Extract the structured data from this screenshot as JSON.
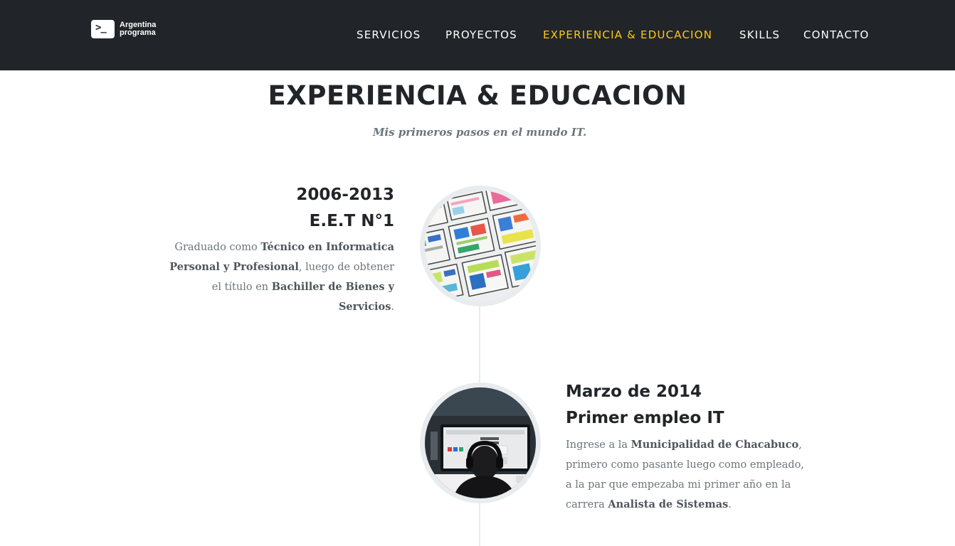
{
  "brand": {
    "prompt": ">_",
    "line1": "Argentina",
    "line2": "programa"
  },
  "nav": {
    "items": [
      {
        "label": "SERVICIOS",
        "active": false
      },
      {
        "label": "PROYECTOS",
        "active": false
      },
      {
        "label": "EXPERIENCIA & EDUCACION",
        "active": true
      },
      {
        "label": "SKILLS",
        "active": false
      },
      {
        "label": "CONTACTO",
        "active": false
      }
    ]
  },
  "section": {
    "heading": "EXPERIENCIA & EDUCACION",
    "subheading": "Mis primeros pasos en el mundo IT."
  },
  "timeline": [
    {
      "date": "2006-2013",
      "title": "E.E.T N°1",
      "image": "wireframe-sketches-image",
      "body": [
        {
          "text": "Graduado como ",
          "bold": false
        },
        {
          "text": "Técnico en Informatica Personal y Profesional",
          "bold": true
        },
        {
          "text": ", luego de obtener el título en ",
          "bold": false
        },
        {
          "text": "Bachiller de Bienes y Servicios",
          "bold": true
        },
        {
          "text": ".",
          "bold": false
        }
      ]
    },
    {
      "date": "Marzo de 2014",
      "title": "Primer empleo IT",
      "image": "person-at-computer-image",
      "body": [
        {
          "text": "Ingrese a la ",
          "bold": false
        },
        {
          "text": "Municipalidad de Chacabuco",
          "bold": true
        },
        {
          "text": ", primero como pasante luego como empleado, a la par que empezaba mi primer año en la carrera ",
          "bold": false
        },
        {
          "text": "Analista de Sistemas",
          "bold": true
        },
        {
          "text": ".",
          "bold": false
        }
      ]
    }
  ],
  "colors": {
    "navbar_bg": "#212529",
    "accent": "#fec810",
    "heading": "#212529",
    "muted": "#6c757d"
  }
}
